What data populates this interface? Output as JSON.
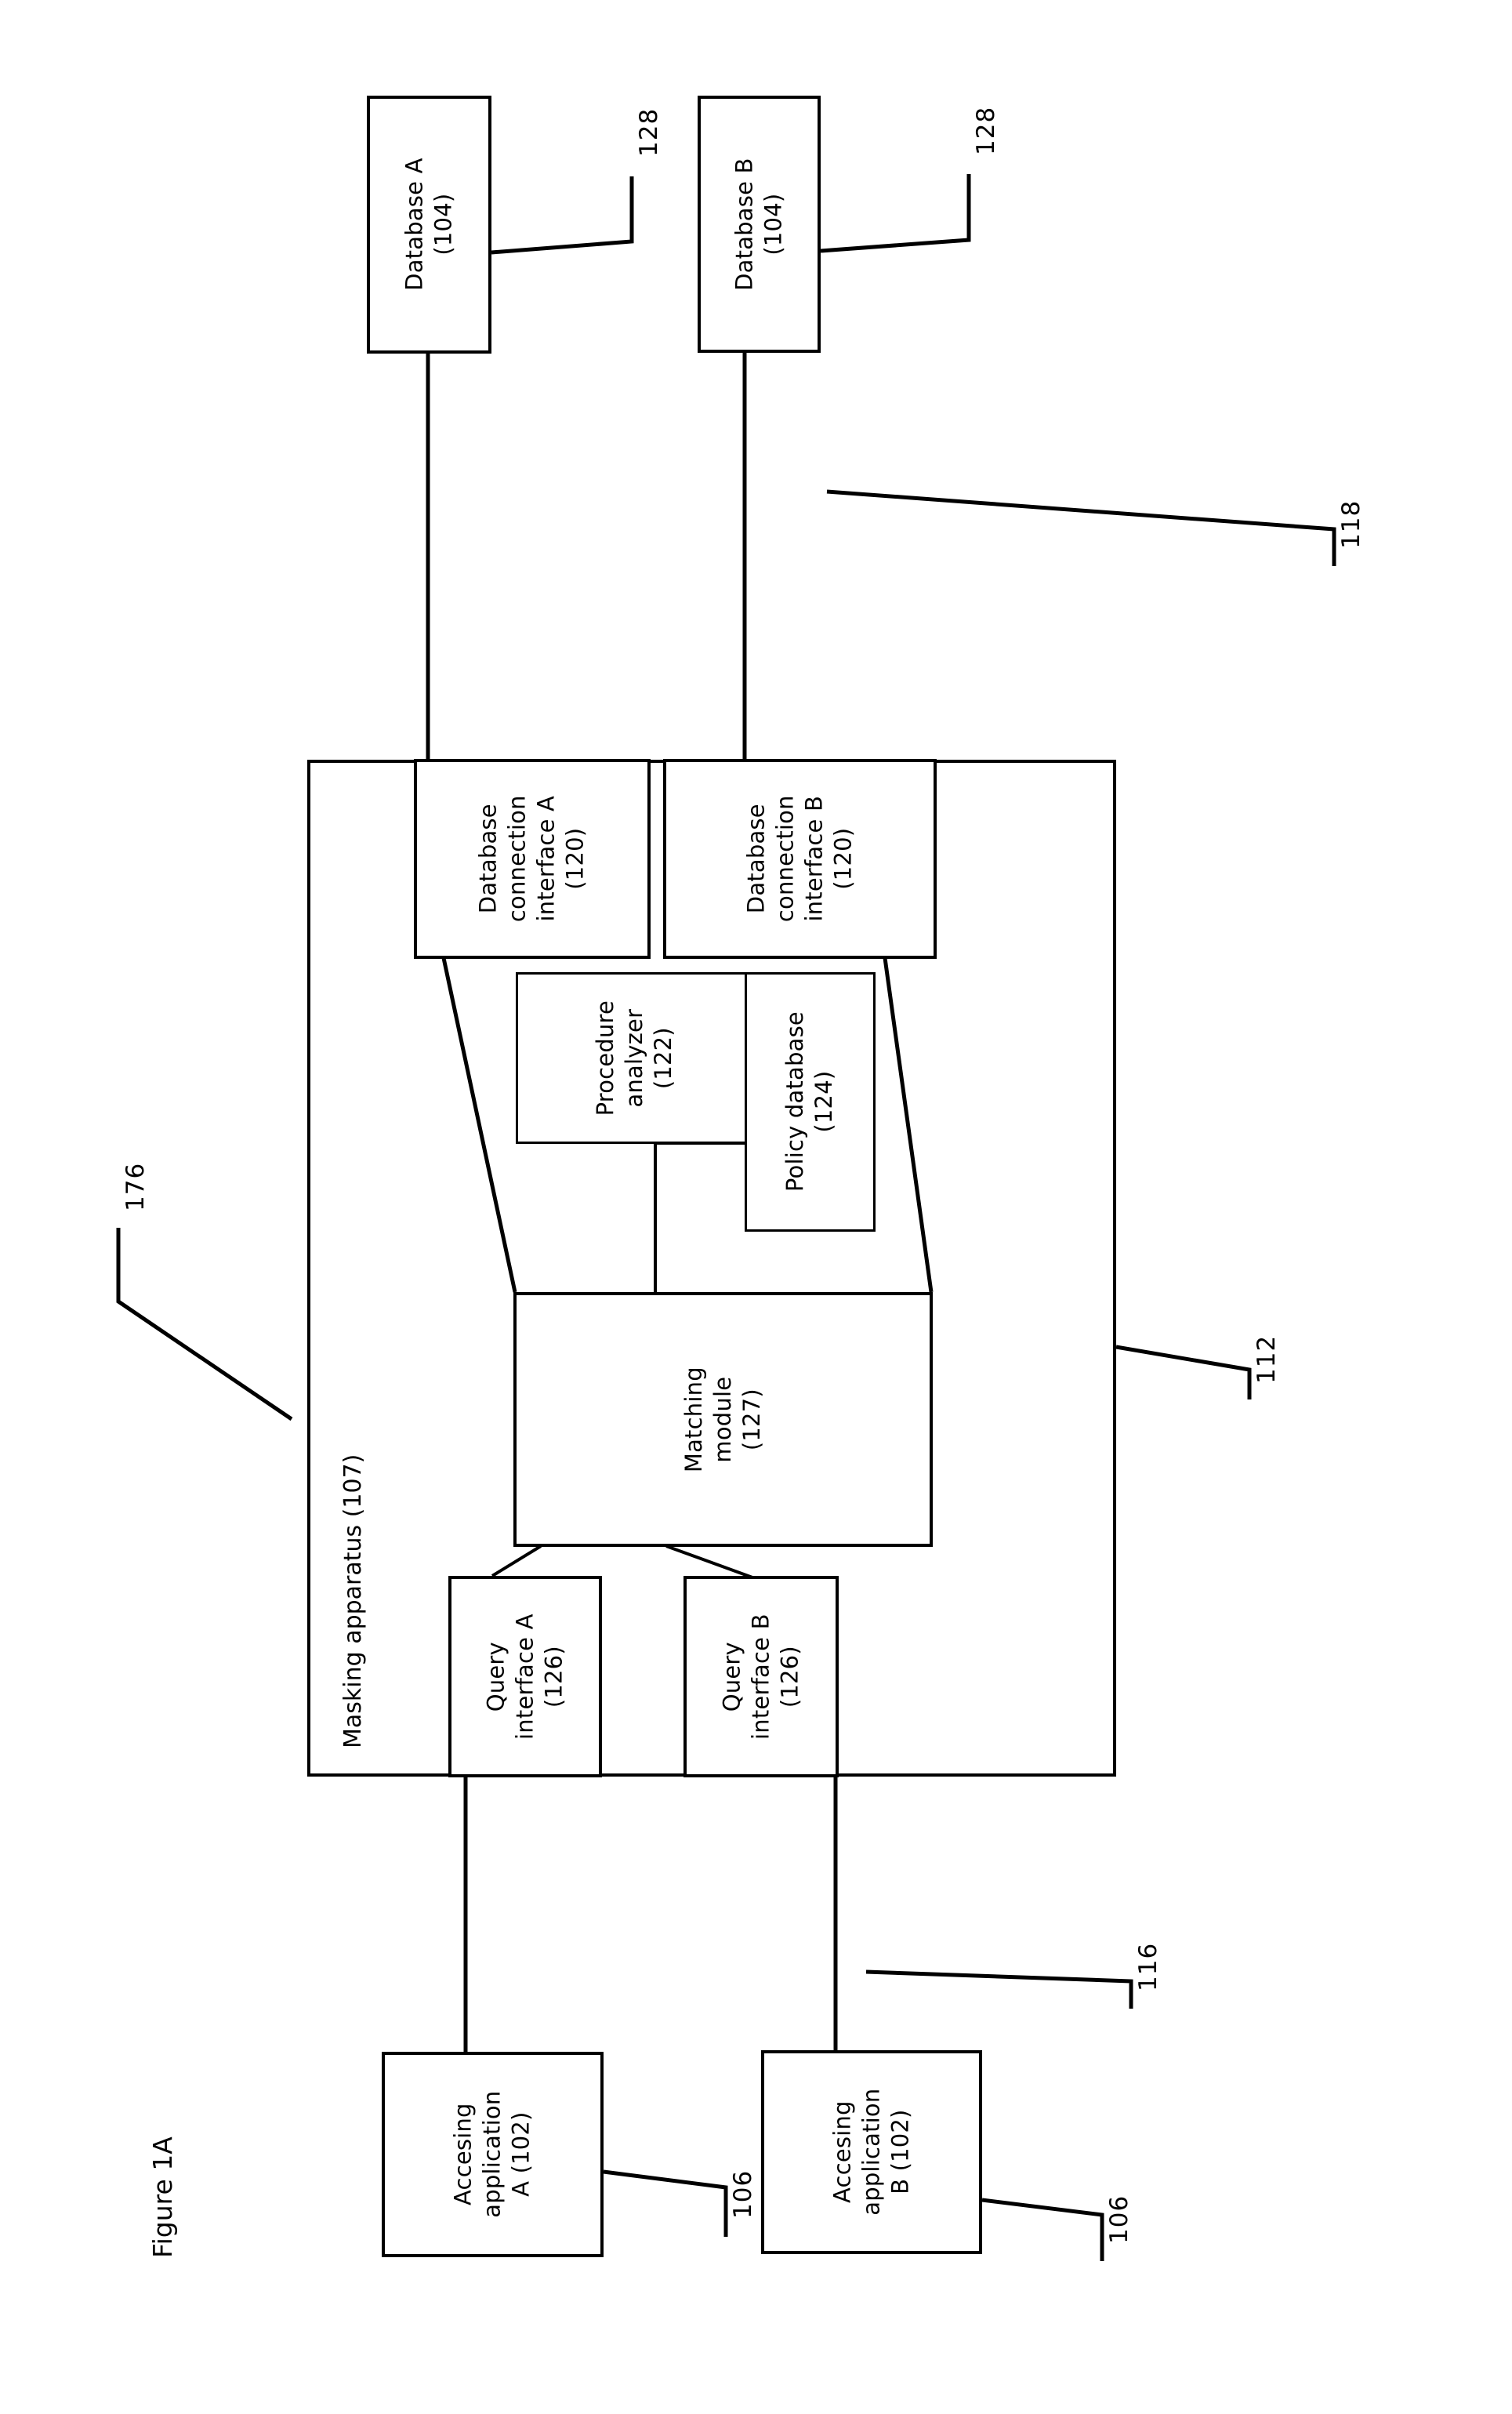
{
  "figure": {
    "title": "Figure 1A"
  },
  "databases": [
    {
      "name": "database-a",
      "label": "Database A\n(104)",
      "ref": "128"
    },
    {
      "name": "database-b",
      "label": "Database B\n(104)",
      "ref": "128"
    }
  ],
  "masking_apparatus": {
    "title": "Masking apparatus (107)",
    "ref": "176",
    "modules": [
      {
        "name": "database-connection-interface-a",
        "label": "Database\nconnection\ninterface A\n(120)"
      },
      {
        "name": "database-connection-interface-b",
        "label": "Database\nconnection\ninterface B\n(120)"
      },
      {
        "name": "procedure-analyzer",
        "label": "Procedure\nanalyzer\n(122)"
      },
      {
        "name": "policy-database",
        "label": "Policy database\n(124)"
      },
      {
        "name": "matching-module",
        "label": "Matching\nmodule\n(127)"
      },
      {
        "name": "query-interface-a",
        "label": "Query\ninterface A\n(126)"
      },
      {
        "name": "query-interface-b",
        "label": "Query\ninterface B\n(126)"
      }
    ]
  },
  "applications": [
    {
      "name": "accessing-application-a",
      "label": "Accesing\napplication\nA (102)",
      "ref": "106"
    },
    {
      "name": "accessing-application-b",
      "label": "Accesing\napplication\nB (102)",
      "ref": "106"
    }
  ],
  "connection_refs": {
    "database_network": "118",
    "apparatus_boundary": "112",
    "application_network": "116"
  },
  "colors": {
    "stroke": "#000000",
    "background": "#ffffff"
  }
}
